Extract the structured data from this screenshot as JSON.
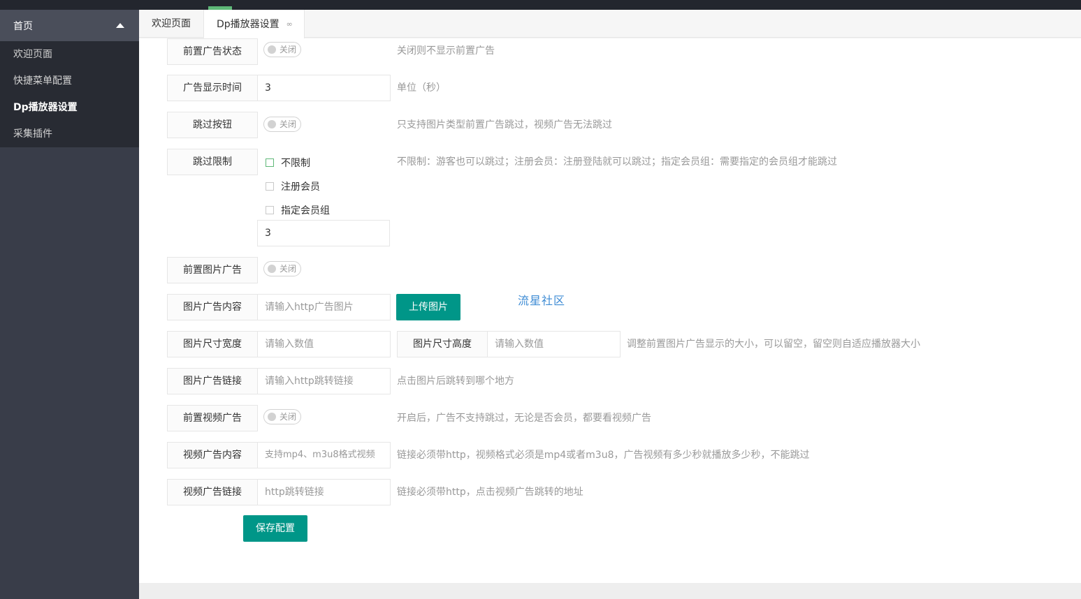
{
  "sidebar": {
    "head": "首页",
    "items": [
      "欢迎页面",
      "快捷菜单配置",
      "Dp播放器设置",
      "采集插件"
    ],
    "active_index": 2
  },
  "tabs": [
    {
      "label": "欢迎页面"
    },
    {
      "label": "Dp播放器设置",
      "close": "∞"
    }
  ],
  "form": {
    "pre_ad_status": {
      "label": "前置广告状态",
      "switch": "关闭",
      "aux": "关闭则不显示前置广告"
    },
    "ad_time": {
      "label": "广告显示时间",
      "value": "3",
      "aux": "单位（秒）"
    },
    "skip_button": {
      "label": "跳过按钮",
      "switch": "关闭",
      "aux": "只支持图片类型前置广告跳过，视频广告无法跳过"
    },
    "skip_limit": {
      "label": "跳过限制",
      "options": [
        "不限制",
        "注册会员",
        "指定会员组"
      ],
      "value": "3",
      "aux": "不限制：游客也可以跳过；注册会员：注册登陆就可以跳过；指定会员组：需要指定的会员组才能跳过"
    },
    "pre_image_ad": {
      "label": "前置图片广告",
      "switch": "关闭"
    },
    "image_content": {
      "label": "图片广告内容",
      "placeholder": "请输入http广告图片",
      "button": "上传图片"
    },
    "image_size": {
      "width_label": "图片尺寸宽度",
      "width_placeholder": "请输入数值",
      "height_label": "图片尺寸高度",
      "height_placeholder": "请输入数值",
      "aux": "调整前置图片广告显示的大小，可以留空，留空则自适应播放器大小"
    },
    "image_link": {
      "label": "图片广告链接",
      "placeholder": "请输入http跳转链接",
      "aux": "点击图片后跳转到哪个地方"
    },
    "pre_video_ad": {
      "label": "前置视频广告",
      "switch": "关闭",
      "aux": "开启后，广告不支持跳过，无论是否会员，都要看视频广告"
    },
    "video_content": {
      "label": "视频广告内容",
      "placeholder": "支持mp4、m3u8格式视频",
      "aux": "链接必须带http，视频格式必须是mp4或者m3u8，广告视频有多少秒就播放多少秒，不能跳过"
    },
    "video_link": {
      "label": "视频广告链接",
      "placeholder": "http跳转链接",
      "aux": "链接必须带http，点击视频广告跳转的地址"
    },
    "save_button": "保存配置"
  },
  "watermark": "流星社区",
  "colors": {
    "primary": "#009688",
    "sidebar": "#393d49",
    "sidebar_sub": "#282b33",
    "topbar": "#23262e"
  }
}
